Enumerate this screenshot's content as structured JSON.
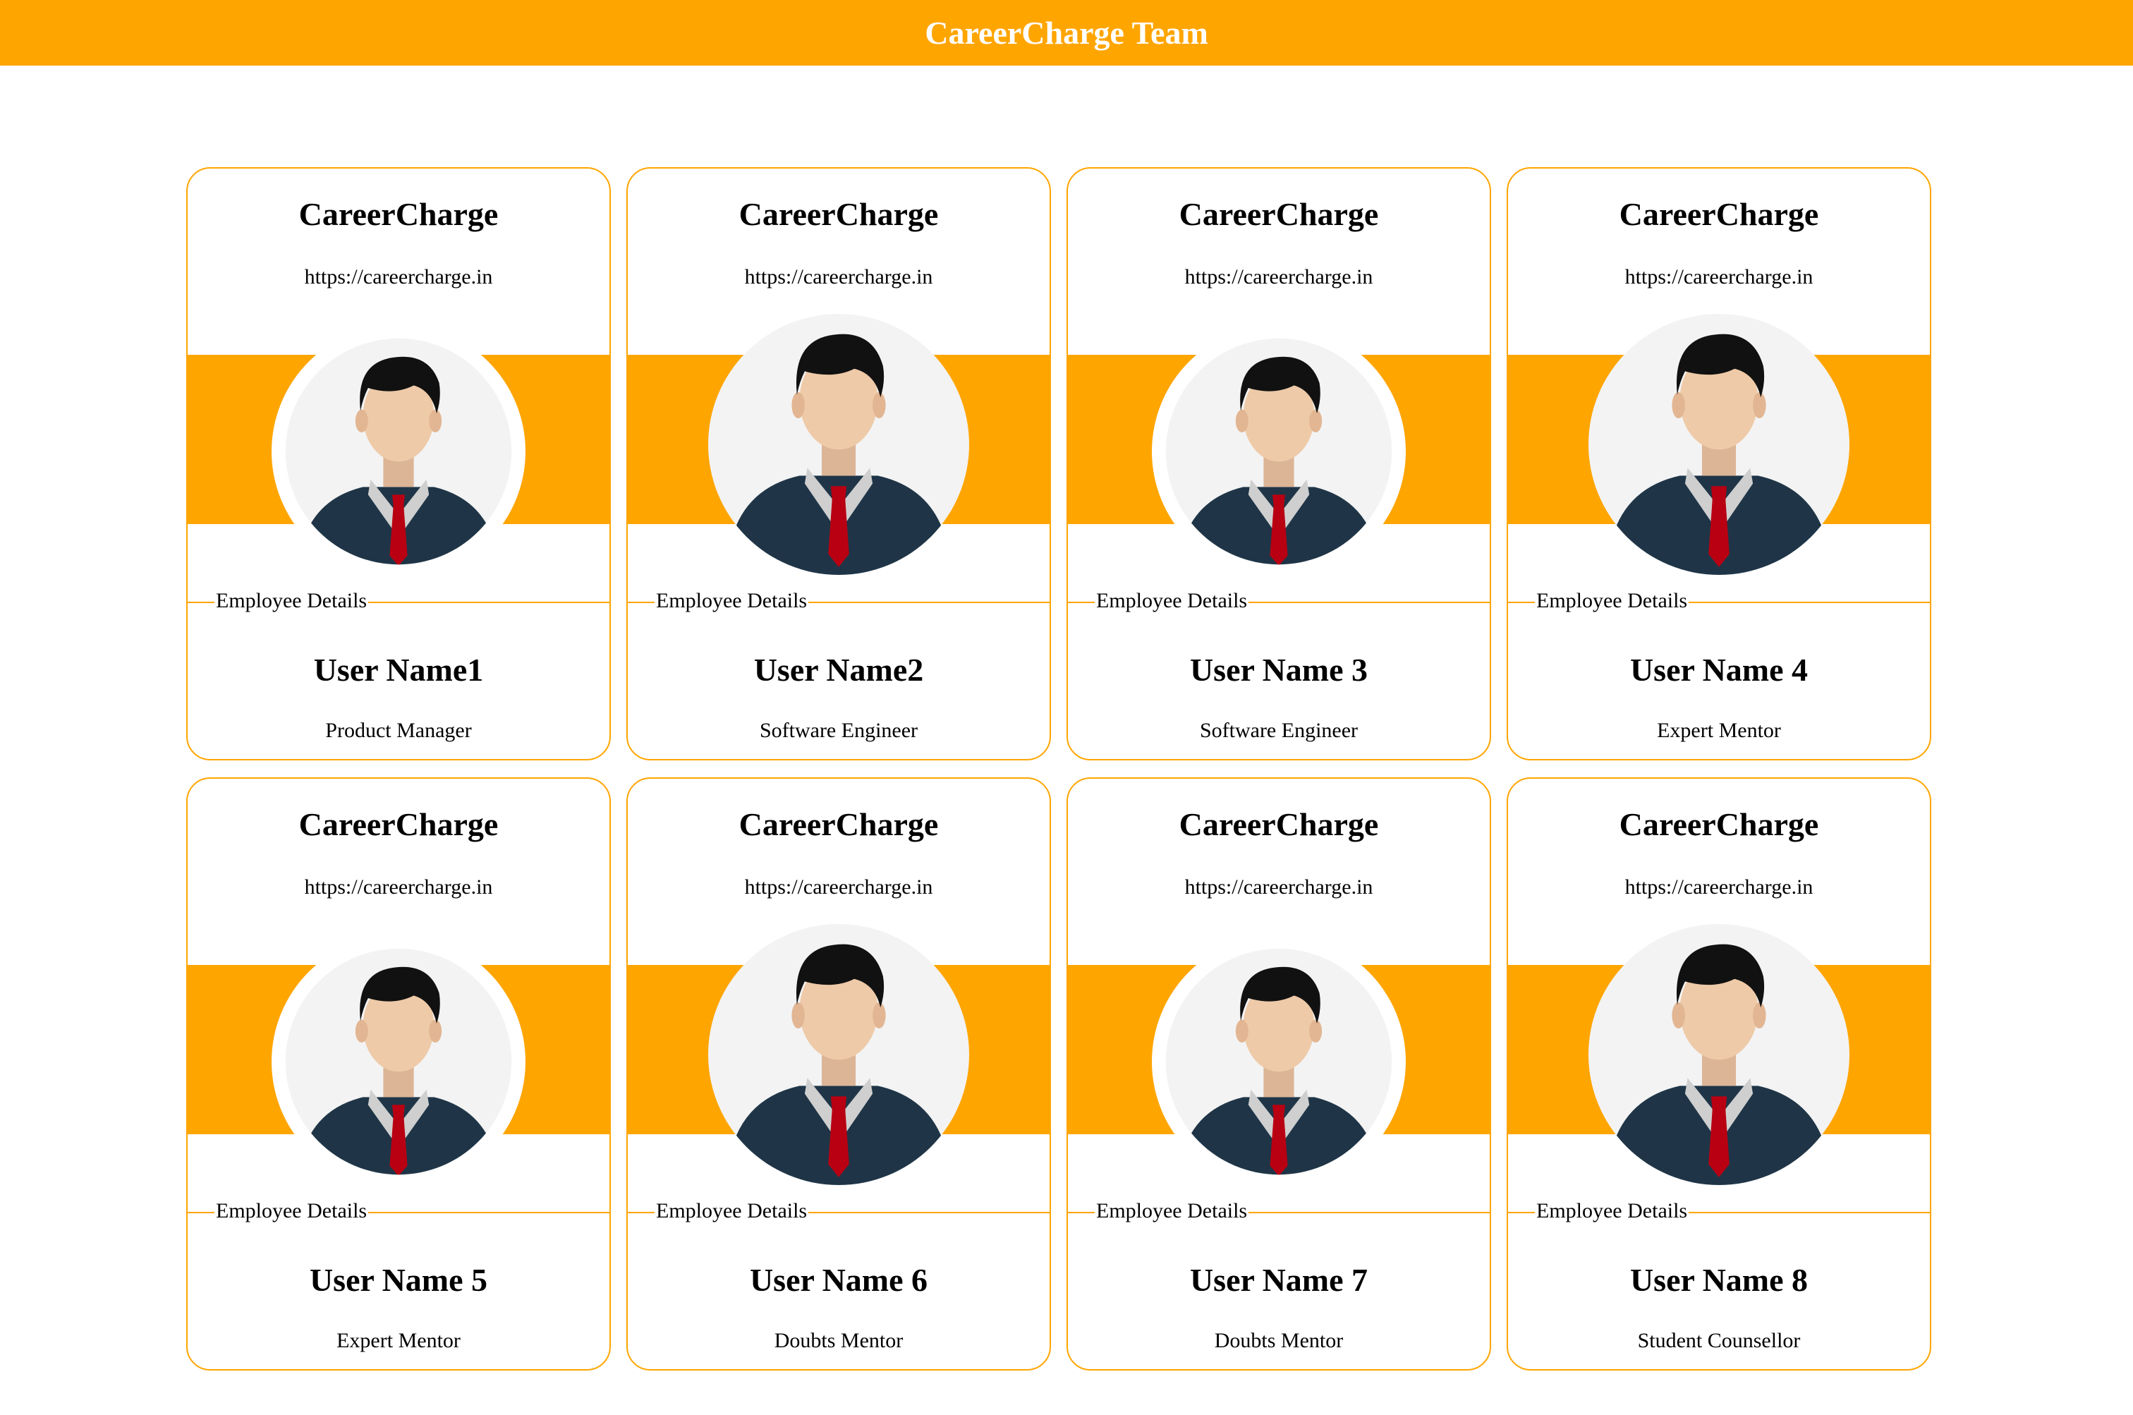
{
  "header": {
    "title": "CareerCharge Team"
  },
  "colors": {
    "accent": "#FFA500",
    "background": "#FFFFFF"
  },
  "cards": [
    {
      "company": "CareerCharge",
      "url": "https://careercharge.in",
      "section_label": "Employee Details",
      "name": "User Name1",
      "role": "Product Manager",
      "avatar_icon": "businessman-avatar-icon"
    },
    {
      "company": "CareerCharge",
      "url": "https://careercharge.in",
      "section_label": "Employee Details",
      "name": "User Name2",
      "role": "Software Engineer",
      "avatar_icon": "businessman-avatar-icon"
    },
    {
      "company": "CareerCharge",
      "url": "https://careercharge.in",
      "section_label": "Employee Details",
      "name": "User Name 3",
      "role": "Software Engineer",
      "avatar_icon": "businessman-avatar-icon"
    },
    {
      "company": "CareerCharge",
      "url": "https://careercharge.in",
      "section_label": "Employee Details",
      "name": "User Name 4",
      "role": "Expert Mentor",
      "avatar_icon": "businessman-avatar-icon"
    },
    {
      "company": "CareerCharge",
      "url": "https://careercharge.in",
      "section_label": "Employee Details",
      "name": "User Name 5",
      "role": "Expert Mentor",
      "avatar_icon": "businessman-avatar-icon"
    },
    {
      "company": "CareerCharge",
      "url": "https://careercharge.in",
      "section_label": "Employee Details",
      "name": "User Name 6",
      "role": "Doubts Mentor",
      "avatar_icon": "businessman-avatar-icon"
    },
    {
      "company": "CareerCharge",
      "url": "https://careercharge.in",
      "section_label": "Employee Details",
      "name": "User Name 7",
      "role": "Doubts Mentor",
      "avatar_icon": "businessman-avatar-icon"
    },
    {
      "company": "CareerCharge",
      "url": "https://careercharge.in",
      "section_label": "Employee Details",
      "name": "User Name 8",
      "role": "Student Counsellor",
      "avatar_icon": "businessman-avatar-icon"
    }
  ]
}
